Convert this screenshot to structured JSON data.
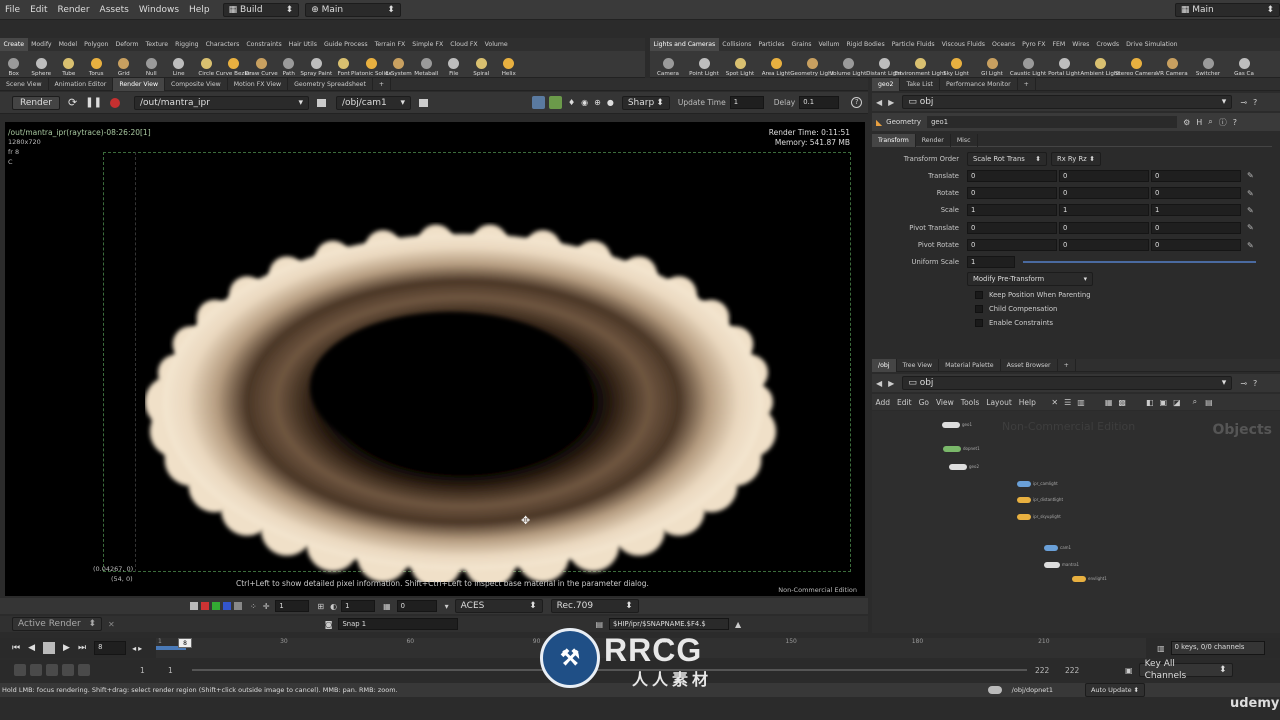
{
  "menubar": {
    "items": [
      "File",
      "Edit",
      "Render",
      "Assets",
      "Windows",
      "Help"
    ],
    "desktop": "Build",
    "context": "Main",
    "right_desktop": "Main"
  },
  "left_shelf": {
    "tabs": [
      "Create",
      "Modify",
      "Model",
      "Polygon",
      "Deform",
      "Texture",
      "Rigging",
      "Characters",
      "Constraints",
      "Hair Utils",
      "Guide Process",
      "Terrain FX",
      "Simple FX",
      "Cloud FX",
      "Volume"
    ],
    "tools": [
      "Box",
      "Sphere",
      "Tube",
      "Torus",
      "Grid",
      "Null",
      "Line",
      "Circle",
      "Curve Bezier",
      "Draw Curve",
      "Path",
      "Spray Paint",
      "Font",
      "Platonic Solids",
      "L-System",
      "Metaball",
      "File",
      "Spiral",
      "Helix"
    ]
  },
  "right_shelf": {
    "tabs": [
      "Lights and Cameras",
      "Collisions",
      "Particles",
      "Grains",
      "Vellum",
      "Rigid Bodies",
      "Particle Fluids",
      "Viscous Fluids",
      "Oceans",
      "Pyro FX",
      "FEM",
      "Wires",
      "Crowds",
      "Drive Simulation"
    ],
    "tools": [
      "Camera",
      "Point Light",
      "Spot Light",
      "Area Light",
      "Geometry Light",
      "Volume Light",
      "Distant Light",
      "Environment Light",
      "Sky Light",
      "GI Light",
      "Caustic Light",
      "Portal Light",
      "Ambient Light",
      "Stereo Camera",
      "VR Camera",
      "Switcher",
      "Gas Ca"
    ]
  },
  "render_tabs": [
    "Scene View",
    "Animation Editor",
    "Render View",
    "Composite View",
    "Motion FX View",
    "Geometry Spreadsheet"
  ],
  "render_toolbar": {
    "render_button": "Render",
    "rop_path": "/out/mantra_ipr",
    "camera_path": "/obj/cam1",
    "filter": "Sharp",
    "update_time_label": "Update Time",
    "update_time": "1",
    "delay_label": "Delay",
    "delay": "0.1"
  },
  "render_overlay": {
    "title": "/out/mantra_ipr(raytrace)-08:26:20[1]",
    "resolution": "1280x720",
    "frame": "fr 8",
    "channel": "C",
    "render_time": "Render Time: 0:11:51",
    "memory": "Memory:   541.87 MB",
    "coords": "(0.04267, 0)",
    "pixel": "(54, 0)",
    "hint": "Ctrl+Left to show detailed pixel information. Shift+Ctrl+Left to inspect base material in the parameter dialog.",
    "edition": "Non-Commercial Edition"
  },
  "render_bottom": {
    "frame_field": "1",
    "gamma": "1",
    "lut_value": "0",
    "colorspace": "ACES",
    "display": "Rec.709",
    "active_render": "Active Render",
    "snap": "Snap 1",
    "snap_path": "$HIP/ipr/$SNAPNAME.$F4.$"
  },
  "param_tabs": [
    "geo2",
    "Take List",
    "Performance Monitor"
  ],
  "param_path": "obj",
  "param_header": {
    "type": "Geometry",
    "name": "geo1"
  },
  "param_subtabs": [
    "Transform",
    "Render",
    "Misc"
  ],
  "params": {
    "transform_order_label": "Transform Order",
    "transform_order": "Scale Rot Trans",
    "rot_order": "Rx Ry Rz",
    "rows": [
      {
        "label": "Translate",
        "values": [
          "0",
          "0",
          "0"
        ]
      },
      {
        "label": "Rotate",
        "values": [
          "0",
          "0",
          "0"
        ]
      },
      {
        "label": "Scale",
        "values": [
          "1",
          "1",
          "1"
        ]
      },
      {
        "label": "Pivot Translate",
        "values": [
          "0",
          "0",
          "0"
        ]
      },
      {
        "label": "Pivot Rotate",
        "values": [
          "0",
          "0",
          "0"
        ]
      }
    ],
    "uniform_scale_label": "Uniform Scale",
    "uniform_scale": "1",
    "modify_pre": "Modify Pre-Transform",
    "checkboxes": [
      "Keep Position When Parenting",
      "Child Compensation",
      "Enable Constraints"
    ]
  },
  "net_tabs": [
    "/obj",
    "Tree View",
    "Material Palette",
    "Asset Browser"
  ],
  "net_path": "obj",
  "net_menu": [
    "Add",
    "Edit",
    "Go",
    "View",
    "Tools",
    "Layout",
    "Help"
  ],
  "net_overlay": {
    "edition": "Non-Commercial Edition",
    "context": "Objects"
  },
  "nodes": [
    "geo1",
    "dopnet1",
    "geo2",
    "ipr_camlight",
    "ipr_distantlight",
    "ipr_skyuplight",
    "cam1",
    "mantra1",
    "envlight1"
  ],
  "timeline": {
    "current_frame": "8",
    "ticks": [
      "1",
      "30",
      "60",
      "90",
      "120",
      "150",
      "180",
      "210"
    ],
    "start": "1",
    "start2": "1",
    "end": "222",
    "end2": "222",
    "keys_info": "0 keys, 0/0 channels",
    "key_all": "Key All Channels"
  },
  "status": {
    "message": "Hold LMB: focus rendering. Shift+drag: select render region (Shift+click outside image to cancel). MMB: pan. RMB: zoom.",
    "path": "/obj/dopnet1",
    "auto_update": "Auto Update"
  },
  "watermark": {
    "brand": "RRCG",
    "sub": "人人素材",
    "site": "udemy"
  }
}
